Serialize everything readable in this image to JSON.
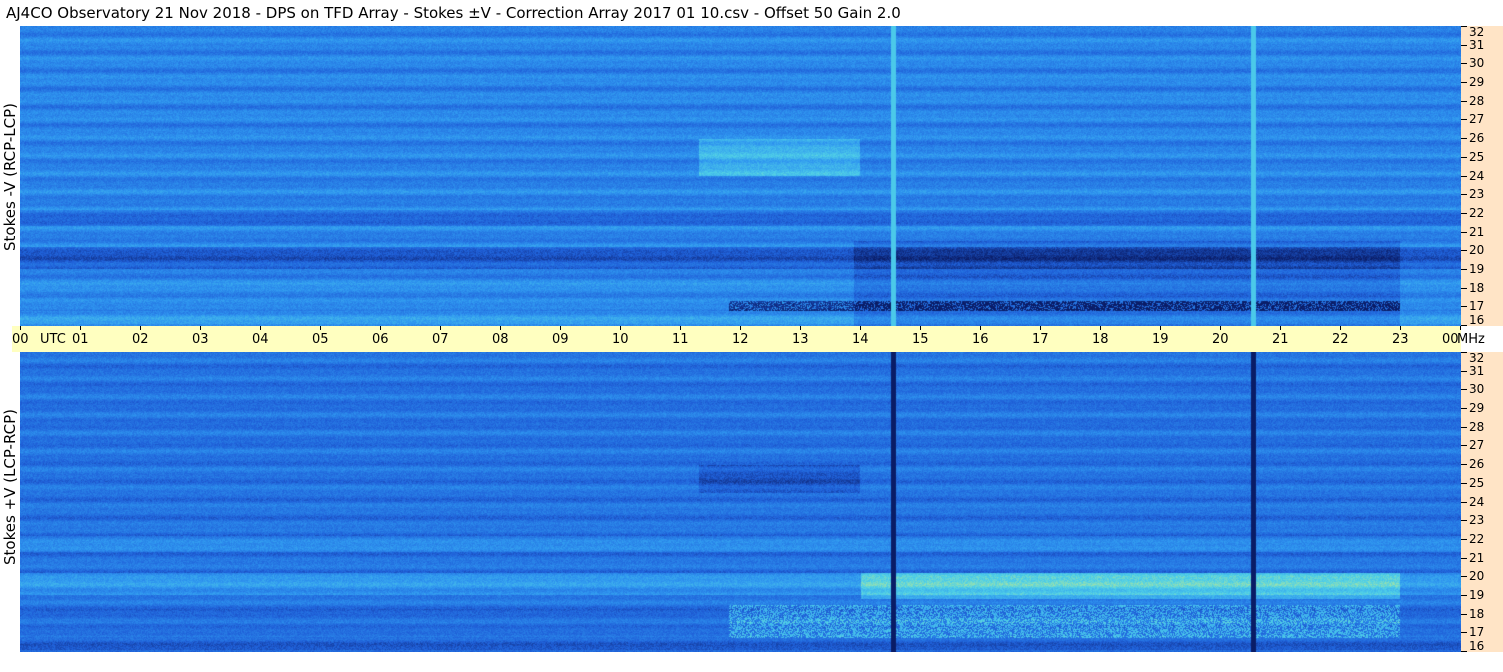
{
  "title": {
    "text": "AJ4CO Observatory  21 Nov 2018  -  DPS on TFD Array  -  Stokes ±V  -  Correction Array 2017 01 10.csv  -  Offset 50  Gain 2.0"
  },
  "chart_data": [
    {
      "type": "heatmap",
      "ylabel": "Stokes -V (RCP-LCP)",
      "ylim": [
        16,
        32
      ],
      "ytick_labels": [
        "16",
        "17",
        "18",
        "19",
        "20",
        "21",
        "22",
        "23",
        "24",
        "25",
        "26",
        "27",
        "28",
        "29",
        "30",
        "31",
        "32"
      ],
      "yunit": "MHz",
      "xlim": [
        0,
        24
      ],
      "xtick_labels": [
        "00",
        "01",
        "02",
        "03",
        "04",
        "05",
        "06",
        "07",
        "08",
        "09",
        "10",
        "11",
        "12",
        "13",
        "14",
        "15",
        "16",
        "17",
        "18",
        "19",
        "20",
        "21",
        "22",
        "23",
        "00"
      ],
      "xunit": "UTC",
      "colormap": [
        "#0a1c66",
        "#1f5fd8",
        "#2f96f0",
        "#4fd0e8",
        "#d8f07a"
      ]
    },
    {
      "type": "heatmap",
      "ylabel": "Stokes +V (LCP-RCP)",
      "ylim": [
        16,
        32
      ],
      "ytick_labels": [
        "16",
        "17",
        "18",
        "19",
        "20",
        "21",
        "22",
        "23",
        "24",
        "25",
        "26",
        "27",
        "28",
        "29",
        "30",
        "31",
        "32"
      ],
      "yunit": "MHz",
      "xlim": [
        0,
        24
      ],
      "xtick_labels": [
        "00",
        "01",
        "02",
        "03",
        "04",
        "05",
        "06",
        "07",
        "08",
        "09",
        "10",
        "11",
        "12",
        "13",
        "14",
        "15",
        "16",
        "17",
        "18",
        "19",
        "20",
        "21",
        "22",
        "23",
        "00"
      ],
      "xunit": "UTC",
      "colormap": [
        "#0a1c66",
        "#1f5fd8",
        "#2f96f0",
        "#4fd0e8",
        "#d8f07a"
      ]
    }
  ],
  "axis": {
    "utc_label": "UTC",
    "mhz_label": "MHz"
  }
}
